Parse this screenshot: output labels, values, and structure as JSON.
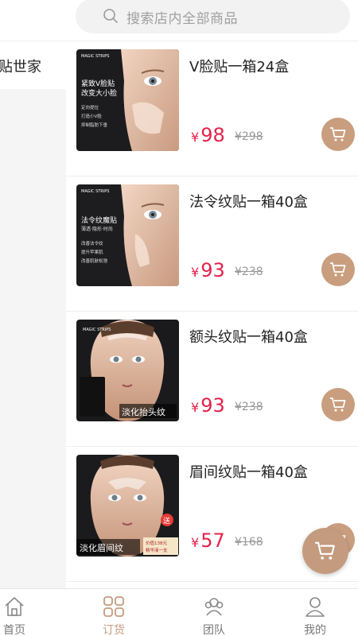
{
  "search": {
    "placeholder": "搜索店内全部商品"
  },
  "sidebar": {
    "active_category": "贴世家"
  },
  "products": [
    {
      "name": "V脸贴一箱24盒",
      "currency": "¥",
      "price": "98",
      "original_price": "¥298",
      "image_title": "紧致V脸贴\n改变大小脸",
      "image_points": [
        "定向提拉",
        "打造小V脸",
        "抑制脂肪下垂"
      ]
    },
    {
      "name": "法令纹贴一箱40盒",
      "currency": "¥",
      "price": "93",
      "original_price": "¥238",
      "image_title": "法令纹魔贴",
      "image_subtitle": "薄透·隐形·时尚",
      "image_points": [
        "改善法令纹",
        "提升苹果肌",
        "改善肌肤松弛"
      ]
    },
    {
      "name": "额头纹贴一箱40盒",
      "currency": "¥",
      "price": "93",
      "original_price": "¥238",
      "image_caption": "淡化抬头纹"
    },
    {
      "name": "眉间纹贴一箱40盒",
      "currency": "¥",
      "price": "57",
      "original_price": "¥168",
      "image_caption": "淡化眉间纹",
      "image_badge": "送",
      "image_gift": "价值138元\n精华液一支"
    }
  ],
  "brand_logo": "MAGIC STRIPS",
  "tabs": [
    {
      "label": "首页",
      "icon": "home-icon",
      "active": false
    },
    {
      "label": "订货",
      "icon": "grid-icon",
      "active": true
    },
    {
      "label": "团队",
      "icon": "team-icon",
      "active": false
    },
    {
      "label": "我的",
      "icon": "user-icon",
      "active": false
    }
  ],
  "colors": {
    "accent": "#c49b7e",
    "price": "#e3224a"
  }
}
